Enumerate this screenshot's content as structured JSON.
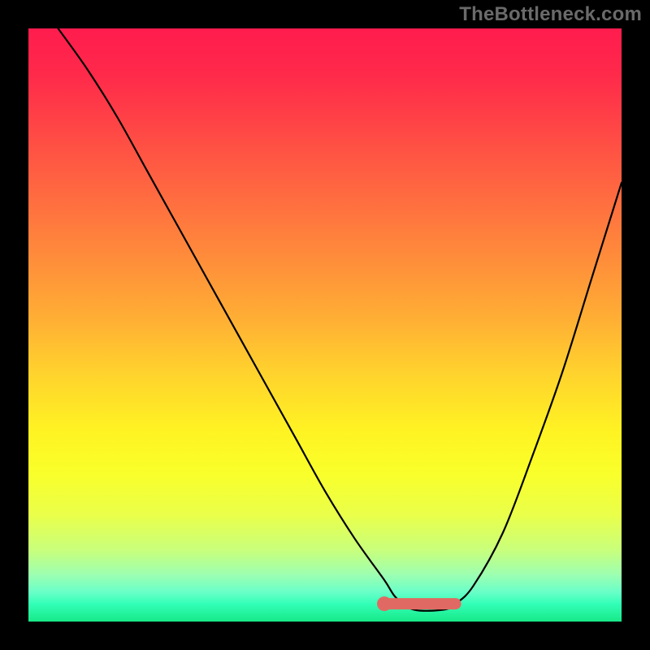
{
  "watermark": "TheBottleneck.com",
  "chart_data": {
    "type": "line",
    "title": "",
    "xlabel": "",
    "ylabel": "",
    "xlim": [
      0,
      100
    ],
    "ylim": [
      0,
      100
    ],
    "series": [
      {
        "name": "bottleneck-curve",
        "x": [
          5,
          10,
          15,
          20,
          25,
          30,
          35,
          40,
          45,
          50,
          55,
          60,
          62,
          65,
          70,
          72,
          75,
          80,
          85,
          90,
          95,
          100
        ],
        "y": [
          100,
          93,
          85,
          76,
          67,
          58,
          49,
          40,
          31,
          22,
          14,
          7,
          4,
          2,
          2,
          3,
          6,
          15,
          28,
          42,
          58,
          74
        ]
      }
    ],
    "highlight": {
      "name": "optimal-range",
      "x": [
        60,
        72
      ],
      "y": [
        3,
        3
      ]
    },
    "colors": {
      "curve": "#000000",
      "highlight": "#e06a63",
      "gradient_top": "#ff1c4e",
      "gradient_bottom": "#17e987"
    }
  }
}
